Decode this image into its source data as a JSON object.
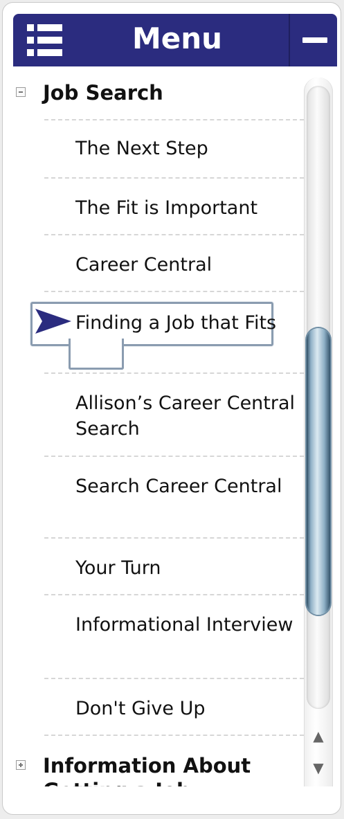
{
  "header": {
    "title": "Menu",
    "menu_icon": "list-icon",
    "collapse_icon": "minus-icon"
  },
  "sections": [
    {
      "label": "Job Search",
      "expanded": true,
      "items": [
        {
          "label": "The Next Step"
        },
        {
          "label": "The Fit is Important"
        },
        {
          "label": "Career Central"
        },
        {
          "label": "Finding a Job that Fits",
          "current": true
        },
        {
          "label": "Allison’s Career Central Search"
        },
        {
          "label": "Search Career Central"
        },
        {
          "label": "Your Turn"
        },
        {
          "label": "Informational Interview"
        },
        {
          "label": "Don't Give Up"
        }
      ]
    },
    {
      "label": "Information About Getting a Job",
      "expanded": false
    }
  ],
  "scrollbar": {
    "up_icon": "arrow-up-icon",
    "down_icon": "arrow-down-icon",
    "up_glyph": "▲",
    "down_glyph": "▼"
  },
  "colors": {
    "header_bg": "#2b2c7f",
    "pointer": "#2b2c7f",
    "highlight_border": "#8a9cb0"
  }
}
